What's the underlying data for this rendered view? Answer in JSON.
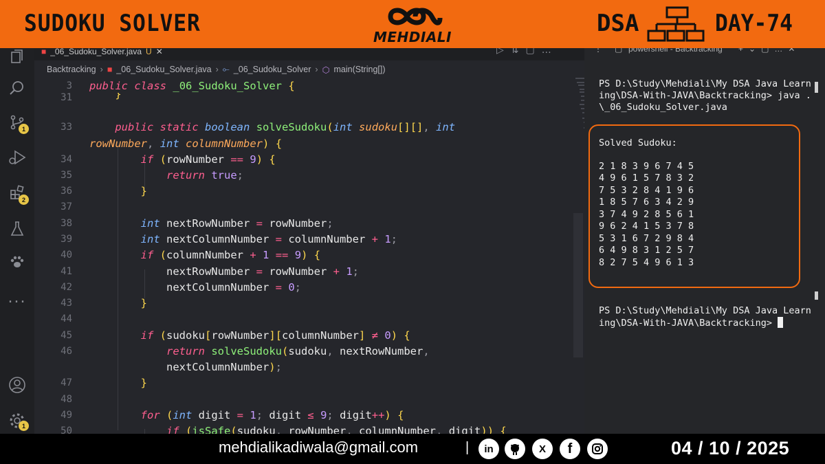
{
  "banner": {
    "title": "SUDOKU SOLVER",
    "logo_text": "MEHDIALI",
    "dsa": "DSA",
    "day": "DAY-74"
  },
  "activity_bar": {
    "badges": {
      "source_control": "1",
      "extensions": "2",
      "settings": "1"
    },
    "more": "..."
  },
  "editor": {
    "tab": {
      "label": "_06_Sudoku_Solver.java",
      "modified": "U"
    },
    "breadcrumb": [
      "Backtracking",
      "_06_Sudoku_Solver.java",
      "_06_Sudoku_Solver",
      "main(String[])"
    ],
    "line_numbers": [
      "3",
      "31",
      "33",
      "",
      "34",
      "35",
      "36",
      "37",
      "38",
      "39",
      "40",
      "41",
      "42",
      "43",
      "44",
      "45",
      "46",
      "",
      "47",
      "48",
      "49",
      "50"
    ]
  },
  "terminal": {
    "tab_label": "powershell - Backtracking",
    "prompt1": "PS D:\\Study\\Mehdiali\\My DSA Java Learn",
    "prompt1b": "ing\\DSA-With-JAVA\\Backtracking> java .",
    "prompt1c": "\\_06_Sudoku_Solver.java",
    "solved_label": "Solved Sudoku:",
    "grid": [
      "2 1 8 3 9 6 7 4 5",
      "4 9 6 1 5 7 8 3 2",
      "7 5 3 2 8 4 1 9 6",
      "1 8 5 7 6 3 4 2 9",
      "3 7 4 9 2 8 5 6 1",
      "9 6 2 4 1 5 3 7 8",
      "5 3 1 6 7 2 9 8 4",
      "6 4 9 8 3 1 2 5 7",
      "8 2 7 5 4 9 6 1 3"
    ],
    "prompt2": "PS D:\\Study\\Mehdiali\\My DSA Java Learn",
    "prompt2b": "ing\\DSA-With-JAVA\\Backtracking> "
  },
  "footer": {
    "email": "mehdialikadiwala@gmail.com",
    "separator": "|",
    "date": "04 / 10 / 2025",
    "socials": [
      "in",
      "github",
      "X",
      "f",
      "instagram"
    ]
  },
  "colors": {
    "accent": "#f26a10",
    "keyword": "#ff5f8f",
    "type": "#7fb6ff",
    "function": "#8ef07a",
    "number": "#c79cff",
    "bracket": "#ffd84d"
  }
}
